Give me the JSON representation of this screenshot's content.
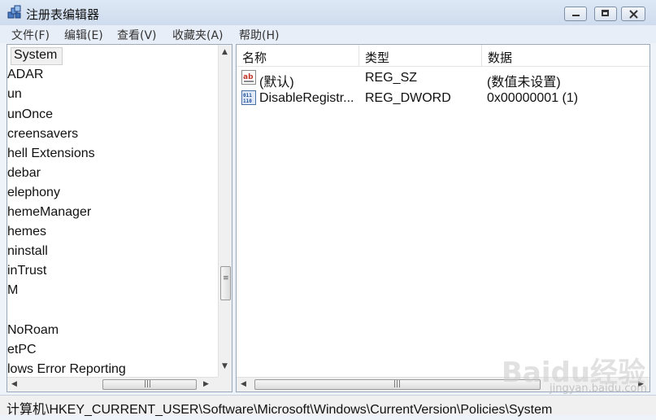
{
  "window": {
    "title": "注册表编辑器"
  },
  "menu": [
    "文件(F)",
    "编辑(E)",
    "查看(V)",
    "收藏夹(A)",
    "帮助(H)"
  ],
  "tree": {
    "selected": "System",
    "items": [
      "ADAR",
      "un",
      "unOnce",
      "creensavers",
      "hell Extensions",
      "debar",
      "elephony",
      "hemeManager",
      "hemes",
      "ninstall",
      "inTrust",
      "M",
      "",
      "NoRoam",
      "etPC",
      "lows Error Reporting"
    ]
  },
  "list": {
    "columns": [
      "名称",
      "类型",
      "数据"
    ],
    "rows": [
      {
        "icon": "string-value-icon",
        "name": "(默认)",
        "type": "REG_SZ",
        "data": "(数值未设置)"
      },
      {
        "icon": "binary-value-icon",
        "name": "DisableRegistr...",
        "type": "REG_DWORD",
        "data": "0x00000001 (1)"
      }
    ]
  },
  "status": {
    "path": "计算机\\HKEY_CURRENT_USER\\Software\\Microsoft\\Windows\\CurrentVersion\\Policies\\System"
  },
  "watermark": {
    "logo": "Baidu经验",
    "url": "jingyan.baidu.com"
  }
}
